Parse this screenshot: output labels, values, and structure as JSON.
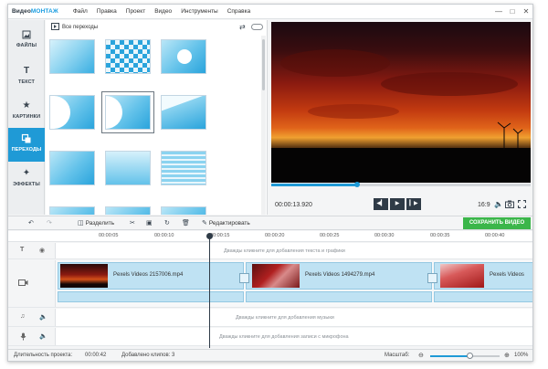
{
  "app": {
    "brand_prefix": "Видео",
    "brand_accent": "МОНТАЖ",
    "menu": [
      "Файл",
      "Правка",
      "Проект",
      "Видео",
      "Инструменты",
      "Справка"
    ],
    "window_controls": [
      "—",
      "□",
      "✕"
    ]
  },
  "sidebar": {
    "items": [
      {
        "label": "ФАЙЛЫ",
        "icon": "files-icon",
        "active": false
      },
      {
        "label": "ТЕКСТ",
        "icon": "text-icon",
        "active": false
      },
      {
        "label": "КАРТИНКИ",
        "icon": "star-icon",
        "active": false
      },
      {
        "label": "ПЕРЕХОДЫ",
        "icon": "transitions-icon",
        "active": true
      },
      {
        "label": "ЭФФЕКТЫ",
        "icon": "effects-icon",
        "active": false
      }
    ]
  },
  "transitions_panel": {
    "title": "Все переходы",
    "selected_index": 4
  },
  "player": {
    "timecode": "00:00:13.920",
    "aspect_ratio": "16:9",
    "progress": 0.33
  },
  "toolbar": {
    "split_label": "Разделить",
    "edit_label": "Редактировать",
    "save_label": "СОХРАНИТЬ ВИДЕО"
  },
  "ruler": {
    "ticks": [
      "00:00:05",
      "00:00:10",
      "00:00:15",
      "00:00:20",
      "00:00:25",
      "00:00:30",
      "00:00:35",
      "00:00:40"
    ]
  },
  "timeline": {
    "text_hint": "Дважды кликните для добавления текста и графики",
    "music_hint": "Дважды кликните для добавления музыки",
    "mic_hint": "Дважды кликните для добавления записи с микрофона",
    "clips": [
      {
        "name": "Pexels Videos 2157006.mp4"
      },
      {
        "name": "Pexels Videos 1494279.mp4"
      },
      {
        "name": "Pexels Videos"
      }
    ]
  },
  "status": {
    "duration_label": "Длительность проекта:",
    "duration_value": "00:00:42",
    "clips_label": "Добавлено клипов: 3",
    "zoom_label": "Масштаб:",
    "zoom_value": "100%",
    "zoom_level": 0.58
  },
  "colors": {
    "accent": "#1f9ad6",
    "save": "#3bb64a",
    "clip": "#bfe2f3"
  }
}
